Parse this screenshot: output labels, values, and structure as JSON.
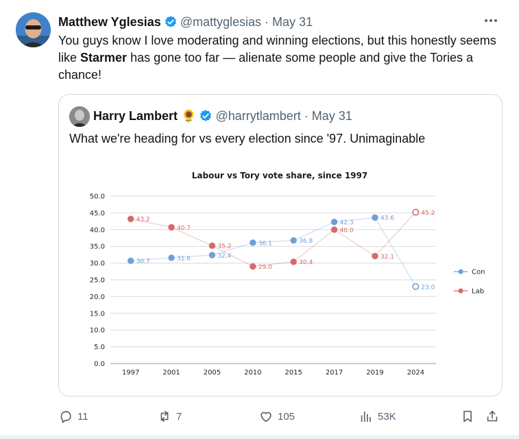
{
  "tweet": {
    "author_name": "Matthew Yglesias",
    "author_handle": "@mattyglesias",
    "separator": "·",
    "date": "May 31",
    "text_before": "You guys know I love moderating and winning elections, but this honestly seems like ",
    "text_bold": "Starmer",
    "text_after": " has gone too far — alienate some people and give the Tories a chance!",
    "icons": {
      "verified": "verified-badge-icon",
      "more": "more-icon"
    },
    "accent_color": "#1d9bf0"
  },
  "quote": {
    "author_name": "Harry Lambert",
    "emoji": "🌻",
    "author_handle": "@harrytlambert",
    "separator": "·",
    "date": "May 31",
    "text": "What we're heading for vs every election since '97. Unimaginable"
  },
  "chart_data": {
    "type": "line",
    "title": "Labour vs Tory vote share, since 1997",
    "xlabel": "",
    "ylabel": "",
    "categories": [
      "1997",
      "2001",
      "2005",
      "2010",
      "2015",
      "2017",
      "2019",
      "2024"
    ],
    "y_ticks": [
      "0.0",
      "5.0",
      "10.0",
      "15.0",
      "20.0",
      "25.0",
      "30.0",
      "35.0",
      "40.0",
      "45.0",
      "50.0"
    ],
    "ylim": [
      0,
      50
    ],
    "grid": true,
    "legend_position": "right",
    "series": [
      {
        "name": "Con",
        "color": "#6f9fd8",
        "values": [
          30.7,
          31.6,
          32.4,
          36.1,
          36.8,
          42.3,
          43.6,
          23.0
        ],
        "labels": [
          "30.7",
          "31.6",
          "32.4",
          "36.1",
          "36.8",
          "42.3",
          "43.6",
          "23.0"
        ]
      },
      {
        "name": "Lab",
        "color": "#d46a6a",
        "values": [
          43.2,
          40.7,
          35.2,
          29.0,
          30.4,
          40.0,
          32.1,
          45.2
        ],
        "labels": [
          "43.2",
          "40.7",
          "35.2",
          "29.0",
          "30.4",
          "40.0",
          "32.1",
          "45.2"
        ]
      }
    ]
  },
  "actions": {
    "replies": "11",
    "reposts": "7",
    "likes": "105",
    "views": "53K",
    "icons": [
      "reply-icon",
      "repost-icon",
      "like-icon",
      "views-icon",
      "bookmark-icon",
      "share-icon"
    ]
  }
}
